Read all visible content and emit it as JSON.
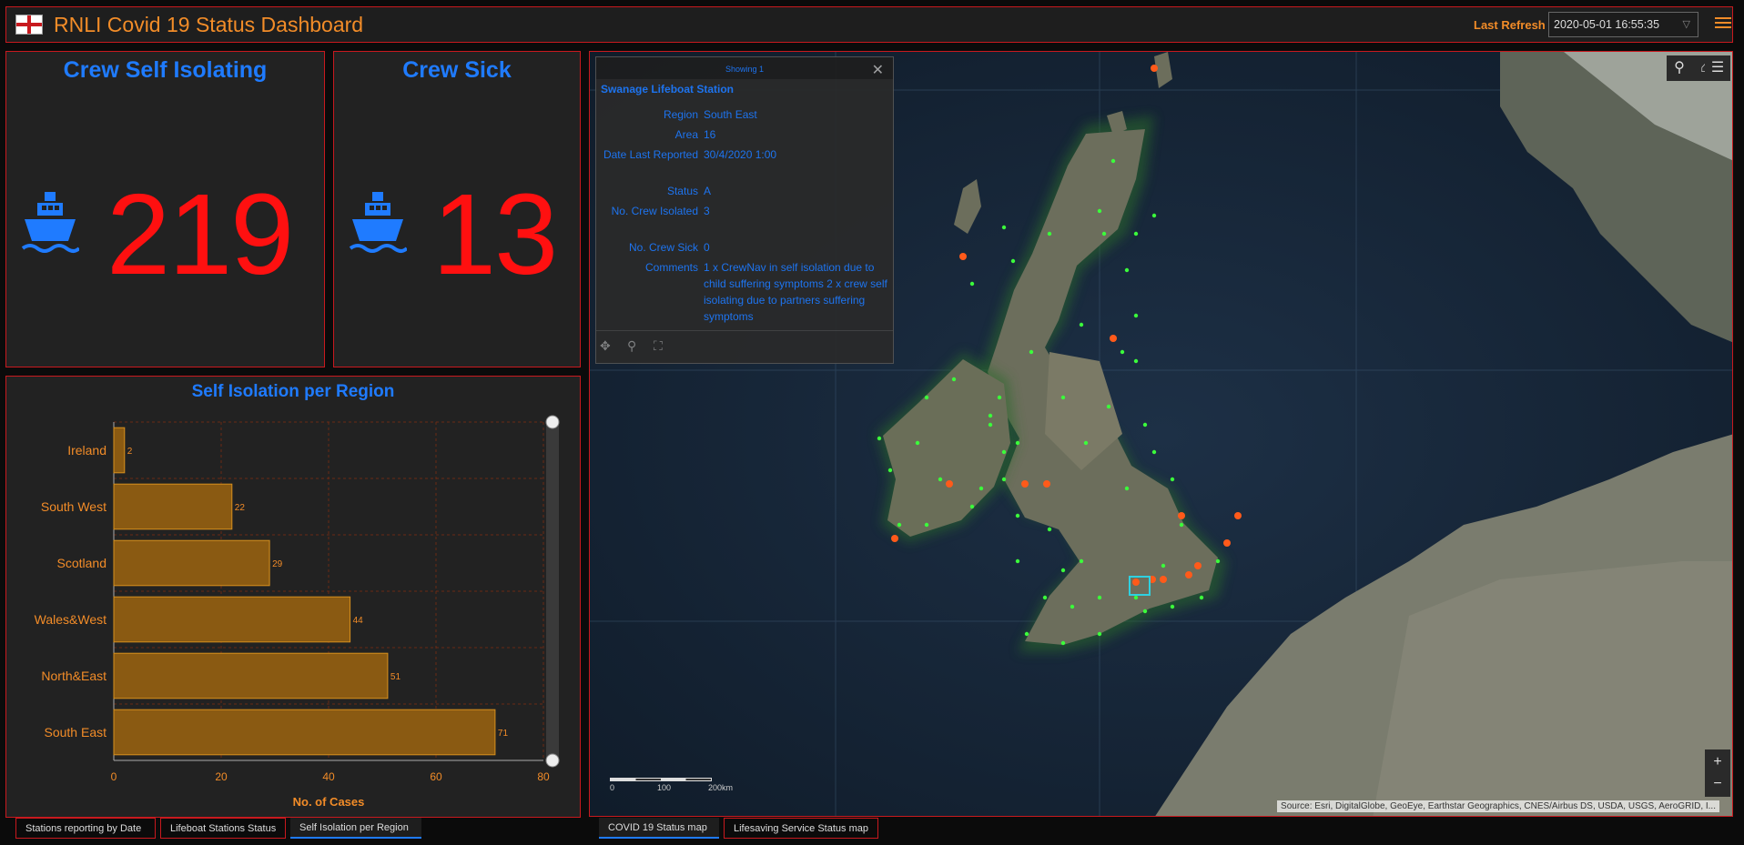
{
  "header": {
    "title": "RNLI Covid 19 Status Dashboard",
    "refresh_label": "Last Refresh :",
    "refresh_value": "2020-05-01 16:55:35"
  },
  "indicators": [
    {
      "title": "Crew Self Isolating",
      "value": "219",
      "icon": "ship-icon",
      "color": "#ff1010"
    },
    {
      "title": "Crew Sick",
      "value": "13",
      "icon": "ship-icon",
      "color": "#ff1010"
    }
  ],
  "chart_data": {
    "type": "bar",
    "orientation": "horizontal",
    "title": "Self Isolation per Region",
    "xlabel": "No. of Cases",
    "ylabel": "",
    "categories": [
      "Ireland",
      "South West",
      "Scotland",
      "Wales&West",
      "North&East",
      "South East"
    ],
    "values": [
      2,
      22,
      29,
      44,
      51,
      71
    ],
    "xlim": [
      0,
      80
    ],
    "xticks": [
      0,
      20,
      40,
      60,
      80
    ],
    "grid": true,
    "bar_color": "#8a5a12",
    "bar_border": "#d7901e"
  },
  "left_tabs": [
    {
      "label": "Stations reporting by Date",
      "active": false
    },
    {
      "label": "Lifeboat Stations Status",
      "active": false
    },
    {
      "label": "Self Isolation per Region",
      "active": true
    }
  ],
  "map_tabs": [
    {
      "label": "COVID 19 Status map",
      "active": true
    },
    {
      "label": "Lifesaving Service Status map",
      "active": false
    }
  ],
  "popup": {
    "header": "Showing 1",
    "title": "Swanage Lifeboat Station",
    "fields": [
      {
        "key": "Region",
        "value": "South East"
      },
      {
        "key": "Area",
        "value": "16"
      },
      {
        "key": "Date Last Reported",
        "value": "30/4/2020 1:00"
      },
      {
        "key": "Status",
        "value": "A"
      },
      {
        "key": "No. Crew Isolated",
        "value": "3"
      },
      {
        "key": "No. Crew Sick",
        "value": "0"
      },
      {
        "key": "Comments",
        "value": "1 x CrewNav in self isolation due to child suffering symptoms 2 x crew self isolating due to partners suffering symptoms"
      }
    ]
  },
  "map": {
    "scale_labels": [
      "0",
      "100",
      "200km"
    ],
    "attribution": "Source: Esri, DigitalGlobe, GeoEye, Earthstar Geographics, CNES/Airbus DS, USDA, USGS, AeroGRID, I...",
    "zoom_in": "+",
    "zoom_out": "−"
  },
  "colors": {
    "accent": "#f28c28",
    "border": "#c8191e",
    "title_blue": "#1f7bff"
  }
}
